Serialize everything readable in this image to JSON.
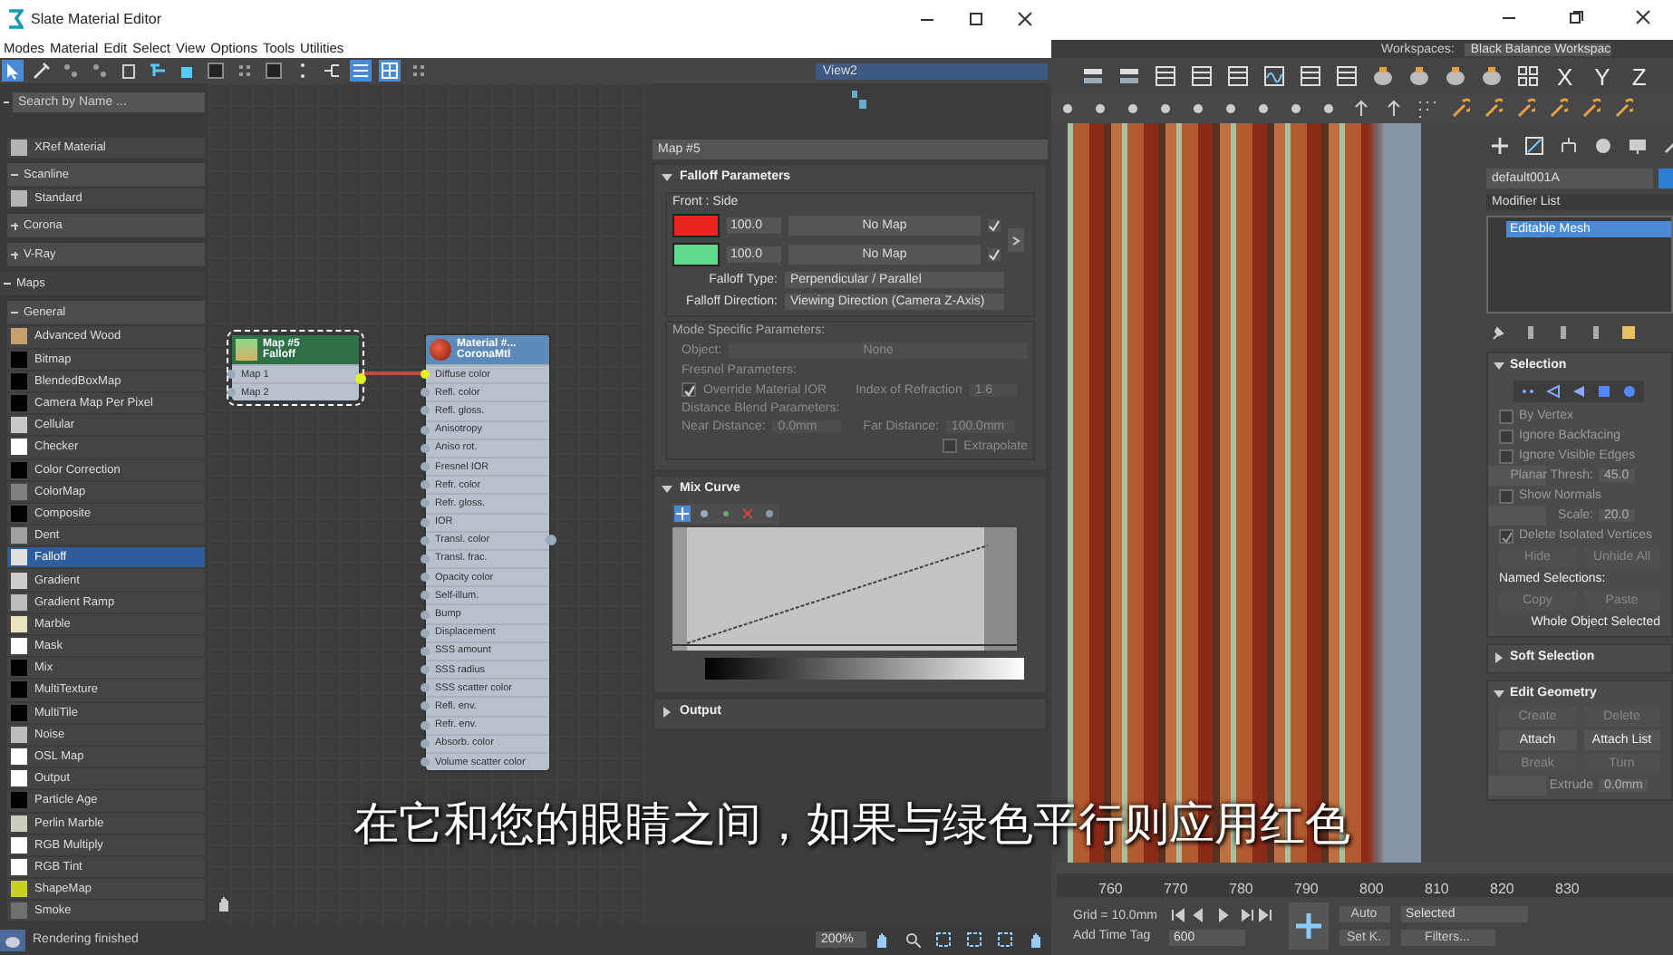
{
  "slate_editor": {
    "title": "Slate Material Editor",
    "menu": [
      "Modes",
      "Material",
      "Edit",
      "Select",
      "View",
      "Options",
      "Tools",
      "Utilities"
    ],
    "view_selector": "View2",
    "browser": {
      "search_placeholder": "Search by Name ...",
      "entries": [
        {
          "kind": "item",
          "label": "XRef Material",
          "color": "#b4b4b4",
          "selected": false
        },
        {
          "kind": "group",
          "label": "Scanline",
          "expanded": true
        },
        {
          "kind": "item",
          "label": "Standard",
          "color": "#b4b4b4",
          "selected": false
        },
        {
          "kind": "group",
          "label": "Corona",
          "expanded": false
        },
        {
          "kind": "group",
          "label": "V-Ray",
          "expanded": false
        },
        {
          "kind": "section",
          "label": "Maps",
          "expanded": true
        },
        {
          "kind": "group",
          "label": "General",
          "expanded": true
        },
        {
          "kind": "item",
          "label": "Advanced Wood",
          "color": "#c8a070",
          "selected": false
        },
        {
          "kind": "item",
          "label": "Bitmap",
          "color": "#000000",
          "selected": false
        },
        {
          "kind": "item",
          "label": "BlendedBoxMap",
          "color": "#000000",
          "selected": false
        },
        {
          "kind": "item",
          "label": "Camera Map Per Pixel",
          "color": "#000000",
          "selected": false
        },
        {
          "kind": "item",
          "label": "Cellular",
          "color": "#c8c8c8",
          "selected": false
        },
        {
          "kind": "item",
          "label": "Checker",
          "color": "#ffffff",
          "selected": false
        },
        {
          "kind": "item",
          "label": "Color Correction",
          "color": "#000000",
          "selected": false
        },
        {
          "kind": "item",
          "label": "ColorMap",
          "color": "#808080",
          "selected": false
        },
        {
          "kind": "item",
          "label": "Composite",
          "color": "#000000",
          "selected": false
        },
        {
          "kind": "item",
          "label": "Dent",
          "color": "#a0a0a0",
          "selected": false
        },
        {
          "kind": "item",
          "label": "Falloff",
          "color": "#e0e0e0",
          "selected": true
        },
        {
          "kind": "item",
          "label": "Gradient",
          "color": "#cccccc",
          "selected": false
        },
        {
          "kind": "item",
          "label": "Gradient Ramp",
          "color": "#bbbbbb",
          "selected": false
        },
        {
          "kind": "item",
          "label": "Marble",
          "color": "#e8e4c0",
          "selected": false
        },
        {
          "kind": "item",
          "label": "Mask",
          "color": "#ffffff",
          "selected": false
        },
        {
          "kind": "item",
          "label": "Mix",
          "color": "#000000",
          "selected": false
        },
        {
          "kind": "item",
          "label": "MultiTexture",
          "color": "#000000",
          "selected": false
        },
        {
          "kind": "item",
          "label": "MultiTile",
          "color": "#000000",
          "selected": false
        },
        {
          "kind": "item",
          "label": "Noise",
          "color": "#bdbdbd",
          "selected": false
        },
        {
          "kind": "item",
          "label": "OSL Map",
          "color": "#ffffff",
          "selected": false
        },
        {
          "kind": "item",
          "label": "Output",
          "color": "#ffffff",
          "selected": false
        },
        {
          "kind": "item",
          "label": "Particle Age",
          "color": "#000000",
          "selected": false
        },
        {
          "kind": "item",
          "label": "Perlin Marble",
          "color": "#c8cec0",
          "selected": false
        },
        {
          "kind": "item",
          "label": "RGB Multiply",
          "color": "#ffffff",
          "selected": false
        },
        {
          "kind": "item",
          "label": "RGB Tint",
          "color": "#ffffff",
          "selected": false
        },
        {
          "kind": "item",
          "label": "ShapeMap",
          "color": "#c8d020",
          "selected": false
        },
        {
          "kind": "item",
          "label": "Smoke",
          "color": "#707070",
          "selected": false
        }
      ]
    },
    "nodes": [
      {
        "kind": "map",
        "title": "Map #5",
        "type": "Falloff",
        "selected": true,
        "slots": [
          "Map 1",
          "Map 2"
        ]
      },
      {
        "kind": "material",
        "title": "Material #...",
        "type": "CoronaMtl",
        "selected": false,
        "slots": [
          "Diffuse color",
          "Refl. color",
          "Refl. gloss.",
          "Anisotropy",
          "Aniso rot.",
          "Fresnel IOR",
          "Refr. color",
          "Refr. gloss.",
          "IOR",
          "Transl. color",
          "Transl. frac.",
          "Opacity color",
          "Self-illum.",
          "Bump",
          "Displacement",
          "SSS amount",
          "SSS radius",
          "SSS scatter color",
          "Refl. env.",
          "Refr. env.",
          "Absorb. color",
          "Volume scatter color"
        ]
      }
    ],
    "params": {
      "title": "Map #5",
      "falloff": {
        "title": "Falloff Parameters",
        "expanded": true,
        "front_side_label": "Front : Side",
        "colors": [
          {
            "color": "#e8261c",
            "amount": "100.0",
            "map": "No Map",
            "enabled": true
          },
          {
            "color": "#5fd98a",
            "amount": "100.0",
            "map": "No Map",
            "enabled": true
          }
        ],
        "falloff_type": {
          "label": "Falloff Type:",
          "value": "Perpendicular / Parallel"
        },
        "falloff_direction": {
          "label": "Falloff Direction:",
          "value": "Viewing Direction (Camera Z-Axis)"
        },
        "mode_specific": {
          "label": "Mode Specific Parameters:",
          "object_label": "Object:",
          "object_value": "None",
          "fresnel_label": "Fresnel Parameters:",
          "override_ior": {
            "label": "Override Material IOR",
            "checked": true
          },
          "ior_label": "Index of Refraction",
          "ior_value": "1.6",
          "distance_label": "Distance Blend Parameters:",
          "near_label": "Near Distance:",
          "near_value": "0.0mm",
          "far_label": "Far Distance:",
          "far_value": "100.0mm",
          "extrapolate": {
            "label": "Extrapolate",
            "checked": false
          }
        }
      },
      "mix_curve": {
        "title": "Mix Curve",
        "expanded": true
      },
      "output": {
        "title": "Output",
        "expanded": false
      }
    },
    "status": "Rendering finished",
    "zoom": "200%"
  },
  "max": {
    "workspaces_label": "Workspaces:",
    "workspace": "Black Balance Workspac",
    "axes": [
      "X",
      "Y",
      "Z"
    ],
    "command_panel": {
      "object_name": "default001A",
      "modifier_list": "Modifier List",
      "stack": [
        {
          "label": "Editable Mesh",
          "selected": true
        }
      ],
      "selection": {
        "title": "Selection",
        "expanded": true,
        "rows": [
          {
            "kind": "check",
            "label": "By Vertex",
            "checked": false
          },
          {
            "kind": "check",
            "label": "Ignore Backfacing",
            "checked": false
          },
          {
            "kind": "check",
            "label": "Ignore Visible Edges",
            "checked": false
          },
          {
            "kind": "spinner",
            "label": "Planar Thresh:",
            "value": "45.0"
          },
          {
            "kind": "check",
            "label": "Show Normals",
            "checked": false
          },
          {
            "kind": "spinner",
            "label": "Scale:",
            "value": "20.0"
          },
          {
            "kind": "check",
            "label": "Delete Isolated Vertices",
            "checked": true
          },
          {
            "kind": "buttons",
            "buttons": [
              {
                "label": "Hide",
                "disabled": true
              },
              {
                "label": "Unhide All",
                "disabled": true
              }
            ]
          },
          {
            "kind": "label",
            "label": "Named Selections:"
          },
          {
            "kind": "buttons",
            "buttons": [
              {
                "label": "Copy",
                "disabled": true
              },
              {
                "label": "Paste",
                "disabled": true
              }
            ]
          },
          {
            "kind": "status",
            "label": "Whole Object Selected"
          }
        ]
      },
      "soft_selection": {
        "title": "Soft Selection",
        "expanded": false
      },
      "edit_geometry": {
        "title": "Edit Geometry",
        "expanded": true,
        "rows": [
          {
            "kind": "buttons",
            "buttons": [
              {
                "label": "Create",
                "disabled": true
              },
              {
                "label": "Delete",
                "disabled": true
              }
            ]
          },
          {
            "kind": "buttons",
            "buttons": [
              {
                "label": "Attach",
                "disabled": false
              },
              {
                "label": "Attach List",
                "disabled": false
              }
            ]
          },
          {
            "kind": "buttons",
            "buttons": [
              {
                "label": "Break",
                "disabled": true
              },
              {
                "label": "Turn",
                "disabled": true
              }
            ]
          },
          {
            "kind": "spinner",
            "label": "Extrude",
            "value": "0.0mm"
          }
        ]
      }
    },
    "timeline_ticks": [
      "760",
      "770",
      "780",
      "790",
      "800",
      "810",
      "820",
      "830"
    ],
    "grid": "Grid = 10.0mm",
    "time_tag": "Add Time Tag",
    "frame": "600",
    "auto_key": "Auto",
    "key_filter": "Selected",
    "set_key": "Set K.",
    "filters": "Filters..."
  },
  "subtitle": "在它和您的眼睛之间，如果与绿色平行则应用红色"
}
